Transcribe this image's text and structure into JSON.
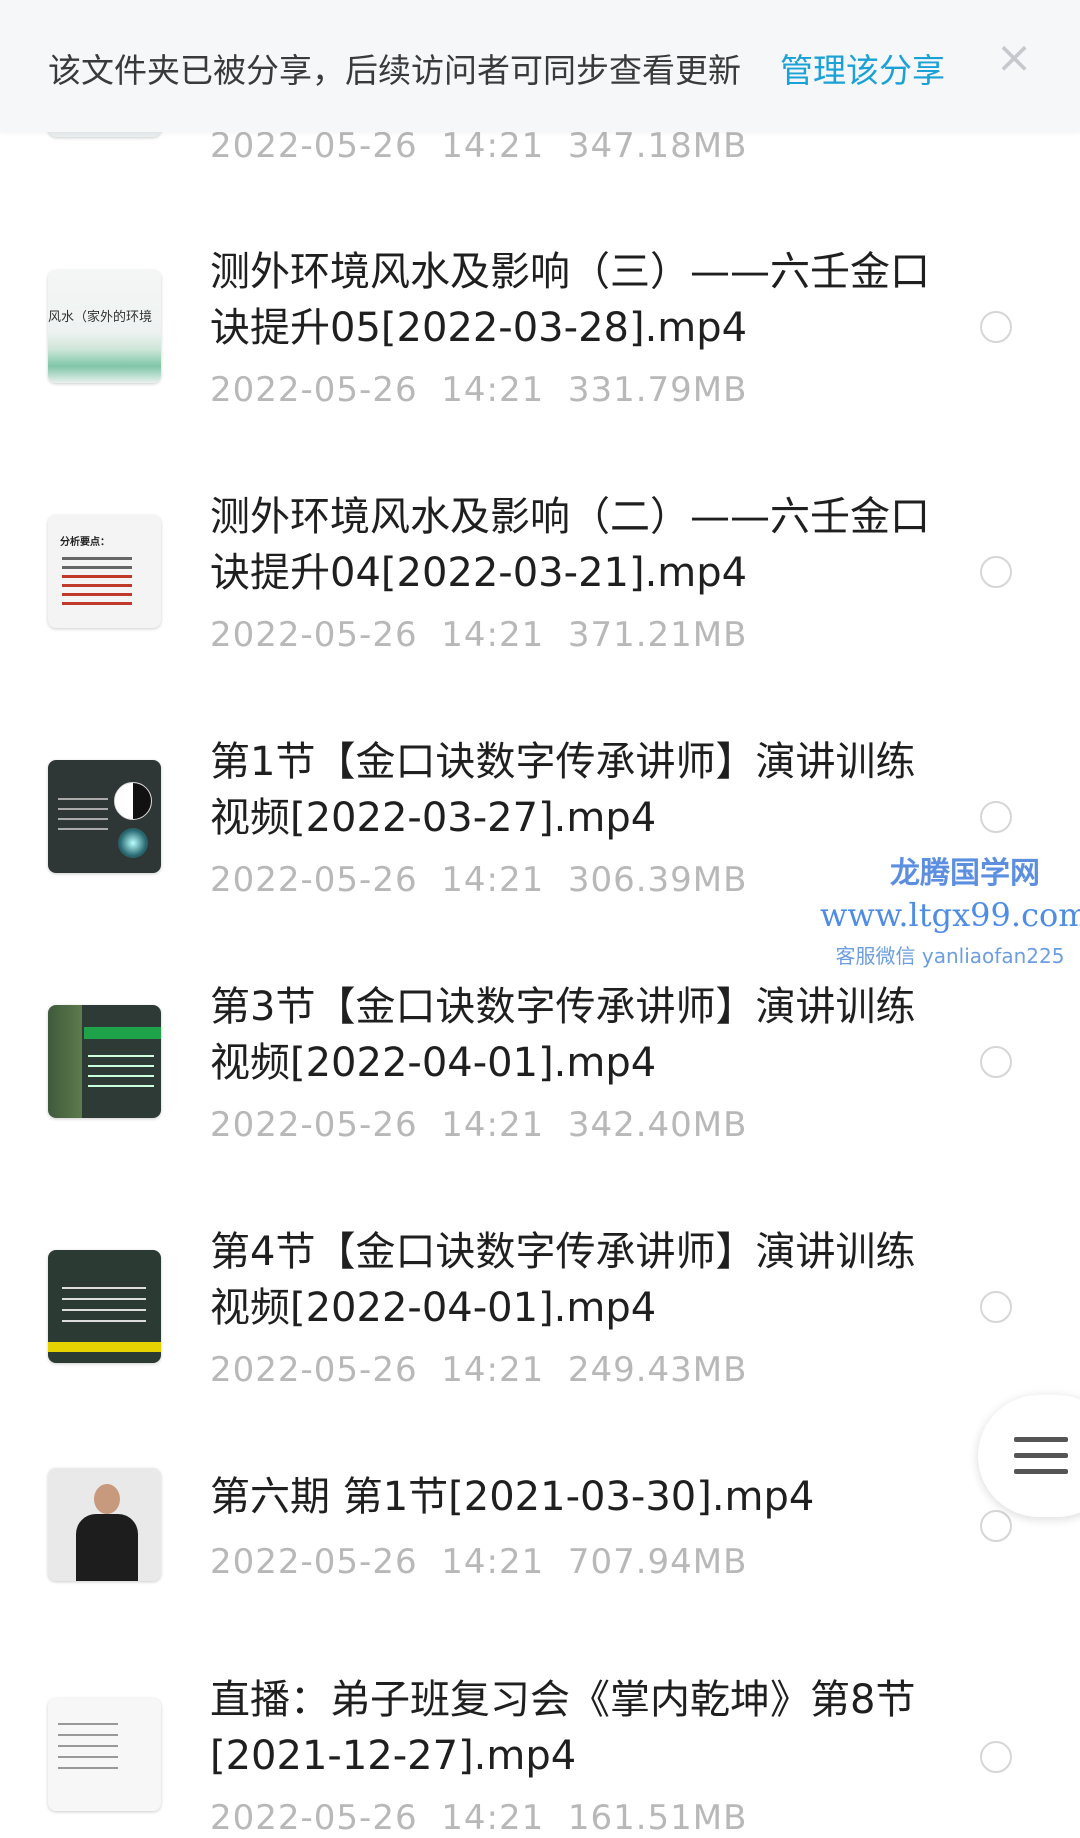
{
  "banner": {
    "message": "该文件夹已被分享，后续访问者可同步查看更新",
    "action": "管理该分享",
    "close_icon": "close-icon"
  },
  "files": [
    {
      "title": "",
      "date": "2022-05-26",
      "time": "14:21",
      "size": "347.18MB",
      "thumb_caption": ""
    },
    {
      "title": "测外环境风水及影响（三）——六壬金口诀提升05[2022-03-28].mp4",
      "date": "2022-05-26",
      "time": "14:21",
      "size": "331.79MB",
      "thumb_caption": "风水（家外的环境"
    },
    {
      "title": "测外环境风水及影响（二）——六壬金口诀提升04[2022-03-21].mp4",
      "date": "2022-05-26",
      "time": "14:21",
      "size": "371.21MB",
      "thumb_caption": "分析要点："
    },
    {
      "title": "第1节【金口诀数字传承讲师】演讲训练视频[2022-03-27].mp4",
      "date": "2022-05-26",
      "time": "14:21",
      "size": "306.39MB",
      "thumb_caption": ""
    },
    {
      "title": "第3节【金口诀数字传承讲师】演讲训练视频[2022-04-01].mp4",
      "date": "2022-05-26",
      "time": "14:21",
      "size": "342.40MB",
      "thumb_caption": ""
    },
    {
      "title": "第4节【金口诀数字传承讲师】演讲训练视频[2022-04-01].mp4",
      "date": "2022-05-26",
      "time": "14:21",
      "size": "249.43MB",
      "thumb_caption": ""
    },
    {
      "title": "第六期  第1节[2021-03-30].mp4",
      "date": "2022-05-26",
      "time": "14:21",
      "size": "707.94MB",
      "thumb_caption": ""
    },
    {
      "title": "直播：弟子班复习会《掌内乾坤》第8节[2021-12-27].mp4",
      "date": "2022-05-26",
      "time": "14:21",
      "size": "161.51MB",
      "thumb_caption": ""
    }
  ],
  "watermark": {
    "name": "龙腾国学网",
    "url": "www.ltgx99.com",
    "contact": "客服微信 yanliaofan225"
  },
  "fab": {
    "icon": "menu-icon"
  }
}
